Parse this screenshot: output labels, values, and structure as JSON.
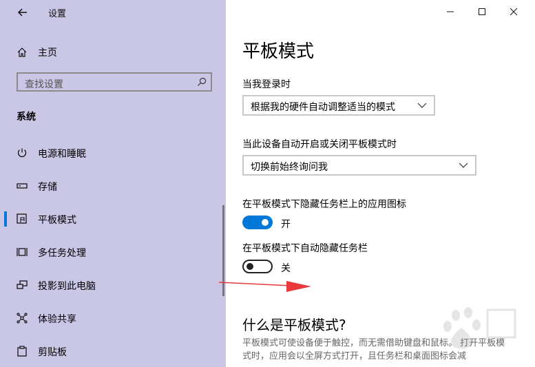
{
  "window": {
    "title": "设置"
  },
  "sidebar": {
    "home_label": "主页",
    "search_placeholder": "查找设置",
    "section_title": "系统",
    "items": [
      {
        "label": "电源和睡眠",
        "icon": "power-icon"
      },
      {
        "label": "存储",
        "icon": "storage-icon"
      },
      {
        "label": "平板模式",
        "icon": "tablet-mode-icon",
        "selected": true
      },
      {
        "label": "多任务处理",
        "icon": "multitasking-icon"
      },
      {
        "label": "投影到此电脑",
        "icon": "project-icon"
      },
      {
        "label": "体验共享",
        "icon": "share-icon"
      },
      {
        "label": "剪贴板",
        "icon": "clipboard-icon"
      }
    ]
  },
  "main": {
    "title": "平板模式",
    "signin_label": "当我登录时",
    "signin_value": "根据我的硬件自动调整适当的模式",
    "auto_switch_label": "当此设备自动开启或关闭平板模式时",
    "auto_switch_value": "切换前始终询问我",
    "hide_icons_label": "在平板模式下隐藏任务栏上的应用图标",
    "hide_icons_state": "开",
    "auto_hide_label": "在平板模式下自动隐藏任务栏",
    "auto_hide_state": "关",
    "what_is_title": "什么是平板模式?",
    "description": "平板模式可使设备便于触控，而无需借助键盘和鼠标。 打开平板模式时，应用会以全屏方式打开，且任务栏和桌面图标会减"
  },
  "colors": {
    "sidebar_bg": "#c9c6e6",
    "accent": "#0078d7",
    "annotation_arrow": "#e83a3a"
  }
}
